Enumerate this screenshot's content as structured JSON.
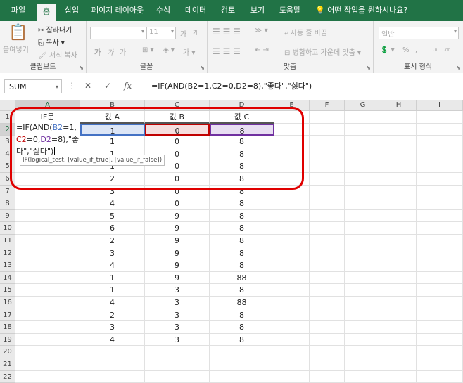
{
  "menu_tabs": [
    "파일",
    "홈",
    "삽입",
    "페이지 레이아웃",
    "수식",
    "데이터",
    "검토",
    "보기",
    "도움말"
  ],
  "active_tab": "홈",
  "tell_me": "어떤 작업을 원하시나요?",
  "ribbon": {
    "clipboard": {
      "paste": "붙여넣기",
      "cut": "잘라내기",
      "copy": "복사",
      "format_painter": "서식 복사",
      "label": "클립보드"
    },
    "font": {
      "size": "11",
      "grow": "가",
      "shrink": "가",
      "bold": "가",
      "italic": "가",
      "underline": "가",
      "label": "글꼴"
    },
    "alignment": {
      "wrap": "자동 줄 바꿈",
      "merge": "병합하고 가운데 맞춤",
      "label": "맞춤"
    },
    "number": {
      "format": "일반",
      "percent": "%",
      "comma": ",",
      "label": "표시 형식"
    }
  },
  "namebox": "SUM",
  "formula": "=IF(AND(B2=1,C2=0,D2=8),\"좋다\",\"싫다\")",
  "columns": [
    "A",
    "B",
    "C",
    "D",
    "E",
    "F",
    "G",
    "H",
    "I"
  ],
  "rows": [
    "1",
    "2",
    "3",
    "4",
    "5",
    "6",
    "7",
    "8",
    "9",
    "10",
    "11",
    "12",
    "13",
    "14",
    "15",
    "16",
    "17",
    "18",
    "19",
    "20",
    "21",
    "22"
  ],
  "headers": {
    "a": "IF문",
    "b": "값 A",
    "c": "값 B",
    "d": "값 C"
  },
  "table": [
    [
      "1",
      "0",
      "8"
    ],
    [
      "1",
      "0",
      "8"
    ],
    [
      "1",
      "0",
      "8"
    ],
    [
      "1",
      "0",
      "8"
    ],
    [
      "2",
      "0",
      "8"
    ],
    [
      "3",
      "0",
      "8"
    ],
    [
      "4",
      "0",
      "8"
    ],
    [
      "5",
      "9",
      "8"
    ],
    [
      "6",
      "9",
      "8"
    ],
    [
      "2",
      "9",
      "8"
    ],
    [
      "3",
      "9",
      "8"
    ],
    [
      "4",
      "9",
      "8"
    ],
    [
      "1",
      "9",
      "88"
    ],
    [
      "1",
      "3",
      "8"
    ],
    [
      "4",
      "3",
      "88"
    ],
    [
      "2",
      "3",
      "8"
    ],
    [
      "3",
      "3",
      "8"
    ],
    [
      "4",
      "3",
      "8"
    ]
  ],
  "edit": {
    "l1a": "=IF(AND(",
    "l1b": "B2",
    "l1c": "=1,",
    "l2a": "C2",
    "l2b": "=0,",
    "l2c": "D2",
    "l2d": "=8),\"좋",
    "l3": "다\",\"싫다\")"
  },
  "tooltip": "IF(logical_test, [value_if_true], [value_if_false])",
  "colors": {
    "excel_green": "#217346",
    "blue_ref": "#4472c4",
    "red_ref": "#c00000",
    "purple_ref": "#7030a0",
    "annotation": "#e00000"
  }
}
